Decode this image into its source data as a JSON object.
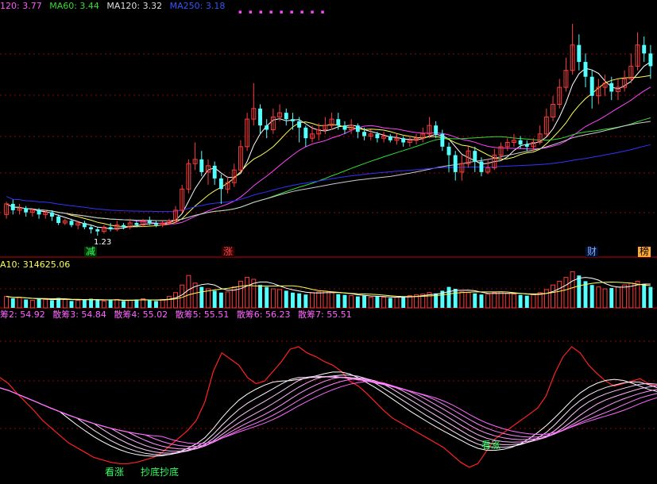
{
  "colors": {
    "up": "#ff3b3b",
    "down": "#54ffff",
    "ma_white": "#ffffff",
    "ma_yellow": "#ffff55",
    "ma_magenta": "#ff44ff",
    "ma_green": "#33dd33",
    "ma_blue": "#3333ff",
    "ma_long": "#cccccc",
    "grid": "#a00000"
  },
  "price_panel": {
    "legend": [
      {
        "label": "120: 3.77",
        "color": "#ff55ff"
      },
      {
        "label": "MA60: 3.44",
        "color": "#33dd33"
      },
      {
        "label": "MA120: 3.32",
        "color": "#dddddd"
      },
      {
        "label": "MA250: 3.18",
        "color": "#3355ff"
      }
    ],
    "event_labels": [
      {
        "text": "减",
        "kind": "reduce"
      },
      {
        "text": "涨",
        "kind": "rise"
      },
      {
        "text": "财",
        "kind": "finance"
      },
      {
        "text": "榜",
        "kind": "list"
      }
    ],
    "price_note": "1.23",
    "marker_dots": "▪ ▪ ▪ ▪ ▪ ▪ ▪ ▪ ▪"
  },
  "volume_panel": {
    "legend": "A10: 314625.06"
  },
  "indicator_panel": {
    "legend": [
      {
        "label": "筹2: 54.92",
        "color": "#ff55ff"
      },
      {
        "label": "散筹3: 54.84",
        "color": "#ff55ff"
      },
      {
        "label": "散筹4: 55.02",
        "color": "#ff55ff"
      },
      {
        "label": "散筹5: 55.51",
        "color": "#ff55ff"
      },
      {
        "label": "散筹6: 56.23",
        "color": "#ff55ff"
      },
      {
        "label": "散筹7: 55.51",
        "color": "#ff55ff"
      }
    ],
    "signals": [
      {
        "text": "看涨"
      },
      {
        "text": "抄底抄底"
      },
      {
        "text": "看涨"
      }
    ]
  },
  "chart_data": {
    "type": "candlestick",
    "candles": [
      [
        0.1,
        0.15,
        0.16,
        0.08
      ],
      [
        0.15,
        0.12,
        0.17,
        0.1
      ],
      [
        0.12,
        0.13,
        0.15,
        0.1
      ],
      [
        0.13,
        0.11,
        0.14,
        0.09
      ],
      [
        0.11,
        0.12,
        0.13,
        0.09
      ],
      [
        0.12,
        0.1,
        0.13,
        0.08
      ],
      [
        0.1,
        0.11,
        0.12,
        0.08
      ],
      [
        0.11,
        0.09,
        0.12,
        0.07
      ],
      [
        0.09,
        0.06,
        0.1,
        0.05
      ],
      [
        0.06,
        0.07,
        0.08,
        0.05
      ],
      [
        0.07,
        0.05,
        0.08,
        0.04
      ],
      [
        0.05,
        0.06,
        0.07,
        0.03
      ],
      [
        0.06,
        0.04,
        0.07,
        0.03
      ],
      [
        0.04,
        0.03,
        0.05,
        0.01
      ],
      [
        0.03,
        0.02,
        0.04,
        0.0
      ],
      [
        0.02,
        0.04,
        0.05,
        0.01
      ],
      [
        0.04,
        0.03,
        0.06,
        0.02
      ],
      [
        0.03,
        0.05,
        0.07,
        0.02
      ],
      [
        0.05,
        0.04,
        0.06,
        0.03
      ],
      [
        0.04,
        0.06,
        0.08,
        0.03
      ],
      [
        0.06,
        0.05,
        0.07,
        0.04
      ],
      [
        0.05,
        0.07,
        0.08,
        0.04
      ],
      [
        0.07,
        0.06,
        0.09,
        0.05
      ],
      [
        0.06,
        0.05,
        0.07,
        0.04
      ],
      [
        0.05,
        0.06,
        0.07,
        0.04
      ],
      [
        0.06,
        0.07,
        0.08,
        0.05
      ],
      [
        0.07,
        0.12,
        0.14,
        0.06
      ],
      [
        0.12,
        0.22,
        0.24,
        0.11
      ],
      [
        0.22,
        0.34,
        0.36,
        0.2
      ],
      [
        0.34,
        0.36,
        0.44,
        0.31
      ],
      [
        0.36,
        0.3,
        0.4,
        0.28
      ],
      [
        0.3,
        0.33,
        0.36,
        0.24
      ],
      [
        0.33,
        0.27,
        0.35,
        0.24
      ],
      [
        0.27,
        0.22,
        0.29,
        0.15
      ],
      [
        0.22,
        0.25,
        0.28,
        0.2
      ],
      [
        0.25,
        0.31,
        0.34,
        0.23
      ],
      [
        0.31,
        0.42,
        0.45,
        0.3
      ],
      [
        0.42,
        0.55,
        0.58,
        0.4
      ],
      [
        0.55,
        0.6,
        0.72,
        0.52
      ],
      [
        0.6,
        0.52,
        0.62,
        0.48
      ],
      [
        0.52,
        0.5,
        0.55,
        0.46
      ],
      [
        0.5,
        0.56,
        0.6,
        0.48
      ],
      [
        0.56,
        0.58,
        0.62,
        0.54
      ],
      [
        0.58,
        0.55,
        0.6,
        0.52
      ],
      [
        0.55,
        0.54,
        0.58,
        0.5
      ],
      [
        0.54,
        0.51,
        0.56,
        0.44
      ],
      [
        0.51,
        0.46,
        0.52,
        0.42
      ],
      [
        0.46,
        0.48,
        0.52,
        0.44
      ],
      [
        0.48,
        0.5,
        0.53,
        0.45
      ],
      [
        0.5,
        0.52,
        0.56,
        0.48
      ],
      [
        0.52,
        0.55,
        0.58,
        0.5
      ],
      [
        0.55,
        0.52,
        0.58,
        0.5
      ],
      [
        0.52,
        0.5,
        0.54,
        0.48
      ],
      [
        0.5,
        0.52,
        0.55,
        0.48
      ],
      [
        0.52,
        0.49,
        0.53,
        0.46
      ],
      [
        0.49,
        0.47,
        0.51,
        0.45
      ],
      [
        0.47,
        0.48,
        0.5,
        0.45
      ],
      [
        0.48,
        0.46,
        0.49,
        0.44
      ],
      [
        0.46,
        0.47,
        0.49,
        0.44
      ],
      [
        0.47,
        0.45,
        0.48,
        0.44
      ],
      [
        0.45,
        0.46,
        0.48,
        0.43
      ],
      [
        0.46,
        0.44,
        0.47,
        0.42
      ],
      [
        0.44,
        0.45,
        0.47,
        0.42
      ],
      [
        0.45,
        0.46,
        0.48,
        0.43
      ],
      [
        0.46,
        0.48,
        0.51,
        0.44
      ],
      [
        0.48,
        0.52,
        0.56,
        0.46
      ],
      [
        0.52,
        0.48,
        0.54,
        0.46
      ],
      [
        0.48,
        0.42,
        0.5,
        0.4
      ],
      [
        0.42,
        0.38,
        0.44,
        0.3
      ],
      [
        0.38,
        0.3,
        0.4,
        0.26
      ],
      [
        0.3,
        0.34,
        0.38,
        0.26
      ],
      [
        0.34,
        0.4,
        0.42,
        0.32
      ],
      [
        0.4,
        0.35,
        0.42,
        0.3
      ],
      [
        0.35,
        0.3,
        0.37,
        0.28
      ],
      [
        0.3,
        0.32,
        0.36,
        0.29
      ],
      [
        0.32,
        0.38,
        0.41,
        0.31
      ],
      [
        0.38,
        0.42,
        0.44,
        0.36
      ],
      [
        0.42,
        0.44,
        0.46,
        0.4
      ],
      [
        0.44,
        0.45,
        0.48,
        0.42
      ],
      [
        0.45,
        0.43,
        0.47,
        0.41
      ],
      [
        0.43,
        0.42,
        0.45,
        0.4
      ],
      [
        0.42,
        0.44,
        0.46,
        0.4
      ],
      [
        0.44,
        0.48,
        0.52,
        0.43
      ],
      [
        0.48,
        0.56,
        0.6,
        0.47
      ],
      [
        0.56,
        0.62,
        0.66,
        0.54
      ],
      [
        0.62,
        0.7,
        0.74,
        0.6
      ],
      [
        0.7,
        0.78,
        0.84,
        0.68
      ],
      [
        0.78,
        0.9,
        1.0,
        0.76
      ],
      [
        0.9,
        0.82,
        0.95,
        0.78
      ],
      [
        0.82,
        0.75,
        0.86,
        0.7
      ],
      [
        0.75,
        0.66,
        0.78,
        0.6
      ],
      [
        0.66,
        0.7,
        0.74,
        0.62
      ],
      [
        0.7,
        0.72,
        0.76,
        0.66
      ],
      [
        0.72,
        0.68,
        0.75,
        0.64
      ],
      [
        0.68,
        0.7,
        0.74,
        0.64
      ],
      [
        0.7,
        0.74,
        0.78,
        0.68
      ],
      [
        0.74,
        0.8,
        0.86,
        0.72
      ],
      [
        0.8,
        0.9,
        0.96,
        0.78
      ],
      [
        0.9,
        0.86,
        0.94,
        0.82
      ],
      [
        0.86,
        0.8,
        0.9,
        0.74
      ]
    ],
    "volume": [
      0.3,
      0.25,
      0.28,
      0.22,
      0.2,
      0.24,
      0.22,
      0.2,
      0.26,
      0.22,
      0.18,
      0.2,
      0.22,
      0.24,
      0.2,
      0.18,
      0.2,
      0.22,
      0.18,
      0.2,
      0.22,
      0.24,
      0.2,
      0.18,
      0.22,
      0.3,
      0.4,
      0.6,
      0.85,
      0.65,
      0.55,
      0.5,
      0.45,
      0.4,
      0.42,
      0.55,
      0.7,
      0.8,
      0.75,
      0.6,
      0.55,
      0.5,
      0.48,
      0.45,
      0.4,
      0.38,
      0.35,
      0.4,
      0.42,
      0.44,
      0.4,
      0.36,
      0.34,
      0.32,
      0.3,
      0.32,
      0.28,
      0.3,
      0.28,
      0.26,
      0.28,
      0.3,
      0.32,
      0.34,
      0.36,
      0.4,
      0.38,
      0.45,
      0.55,
      0.5,
      0.42,
      0.4,
      0.38,
      0.35,
      0.36,
      0.4,
      0.42,
      0.38,
      0.36,
      0.34,
      0.32,
      0.35,
      0.4,
      0.48,
      0.6,
      0.7,
      0.8,
      0.95,
      0.85,
      0.7,
      0.6,
      0.55,
      0.5,
      0.52,
      0.55,
      0.6,
      0.65,
      0.7,
      0.62,
      0.55
    ],
    "oscillator": {
      "red_line": [
        0.75,
        0.7,
        0.62,
        0.55,
        0.48,
        0.4,
        0.34,
        0.28,
        0.22,
        0.18,
        0.14,
        0.1,
        0.08,
        0.06,
        0.05,
        0.05,
        0.06,
        0.08,
        0.1,
        0.14,
        0.2,
        0.26,
        0.32,
        0.4,
        0.55,
        0.8,
        0.95,
        0.9,
        0.85,
        0.75,
        0.7,
        0.72,
        0.8,
        0.88,
        0.98,
        1.0,
        0.95,
        0.92,
        0.88,
        0.85,
        0.8,
        0.72,
        0.68,
        0.62,
        0.55,
        0.48,
        0.42,
        0.38,
        0.34,
        0.3,
        0.26,
        0.22,
        0.18,
        0.12,
        0.06,
        0.02,
        0.05,
        0.15,
        0.25,
        0.3,
        0.35,
        0.4,
        0.45,
        0.5,
        0.6,
        0.78,
        0.92,
        1.0,
        0.95,
        0.85,
        0.78,
        0.72,
        0.68,
        0.7,
        0.72,
        0.74,
        0.7,
        0.68
      ],
      "fan_count": 7
    }
  }
}
